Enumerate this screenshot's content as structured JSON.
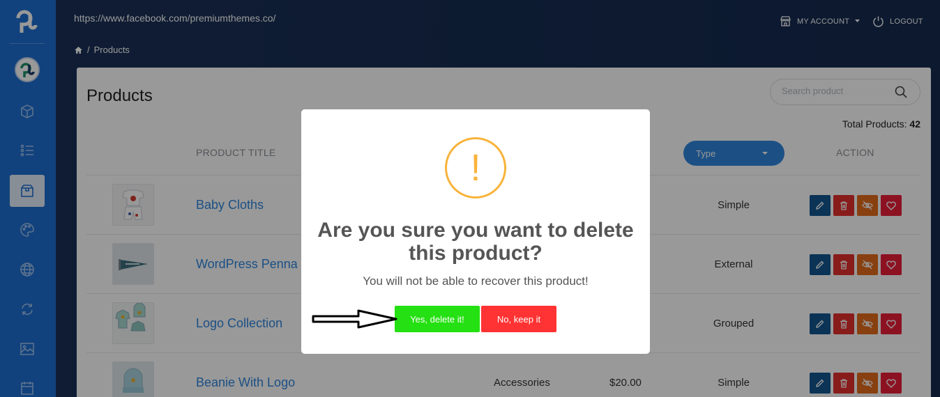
{
  "header": {
    "url": "https://www.facebook.com/premiumthemes.co/",
    "breadcrumb": "Products",
    "account_label": "MY ACCOUNT",
    "logout_label": "LOGOUT"
  },
  "brand": {
    "logo_text": "pt"
  },
  "sidebar": {
    "items": [
      {
        "icon": "cube-icon"
      },
      {
        "icon": "list-icon"
      },
      {
        "icon": "products-box-icon",
        "active": true
      },
      {
        "icon": "palette-icon"
      },
      {
        "icon": "globe-icon"
      },
      {
        "icon": "refresh-icon"
      },
      {
        "icon": "image-icon"
      },
      {
        "icon": "calendar-icon"
      }
    ]
  },
  "page": {
    "title": "Products",
    "search_placeholder": "Search product",
    "total_label": "Total Products:",
    "total_value": "42"
  },
  "table": {
    "col_title": "PRODUCT TITLE",
    "col_type": "Type",
    "col_action": "ACTION",
    "rows": [
      {
        "title": "Baby Cloths",
        "category": "",
        "price": "",
        "type": "Simple"
      },
      {
        "title": "WordPress Penna",
        "category": "",
        "price": "",
        "type": "External"
      },
      {
        "title": "Logo Collection",
        "category": "",
        "price": "",
        "type": "Grouped"
      },
      {
        "title": "Beanie With Logo",
        "category": "Accessories",
        "price": "$20.00",
        "type": "Simple"
      }
    ]
  },
  "modal": {
    "icon": "!",
    "title": "Are you sure you want to delete this product?",
    "text": "You will not be able to recover this product!",
    "confirm_label": "Yes, delete it!",
    "cancel_label": "No, keep it"
  },
  "colors": {
    "sidebar": "#1e6ed1",
    "header": "#1a3057",
    "link": "#2f86dc",
    "confirm": "#25e012",
    "cancel": "#ff3333",
    "warning": "#f8b33a"
  }
}
